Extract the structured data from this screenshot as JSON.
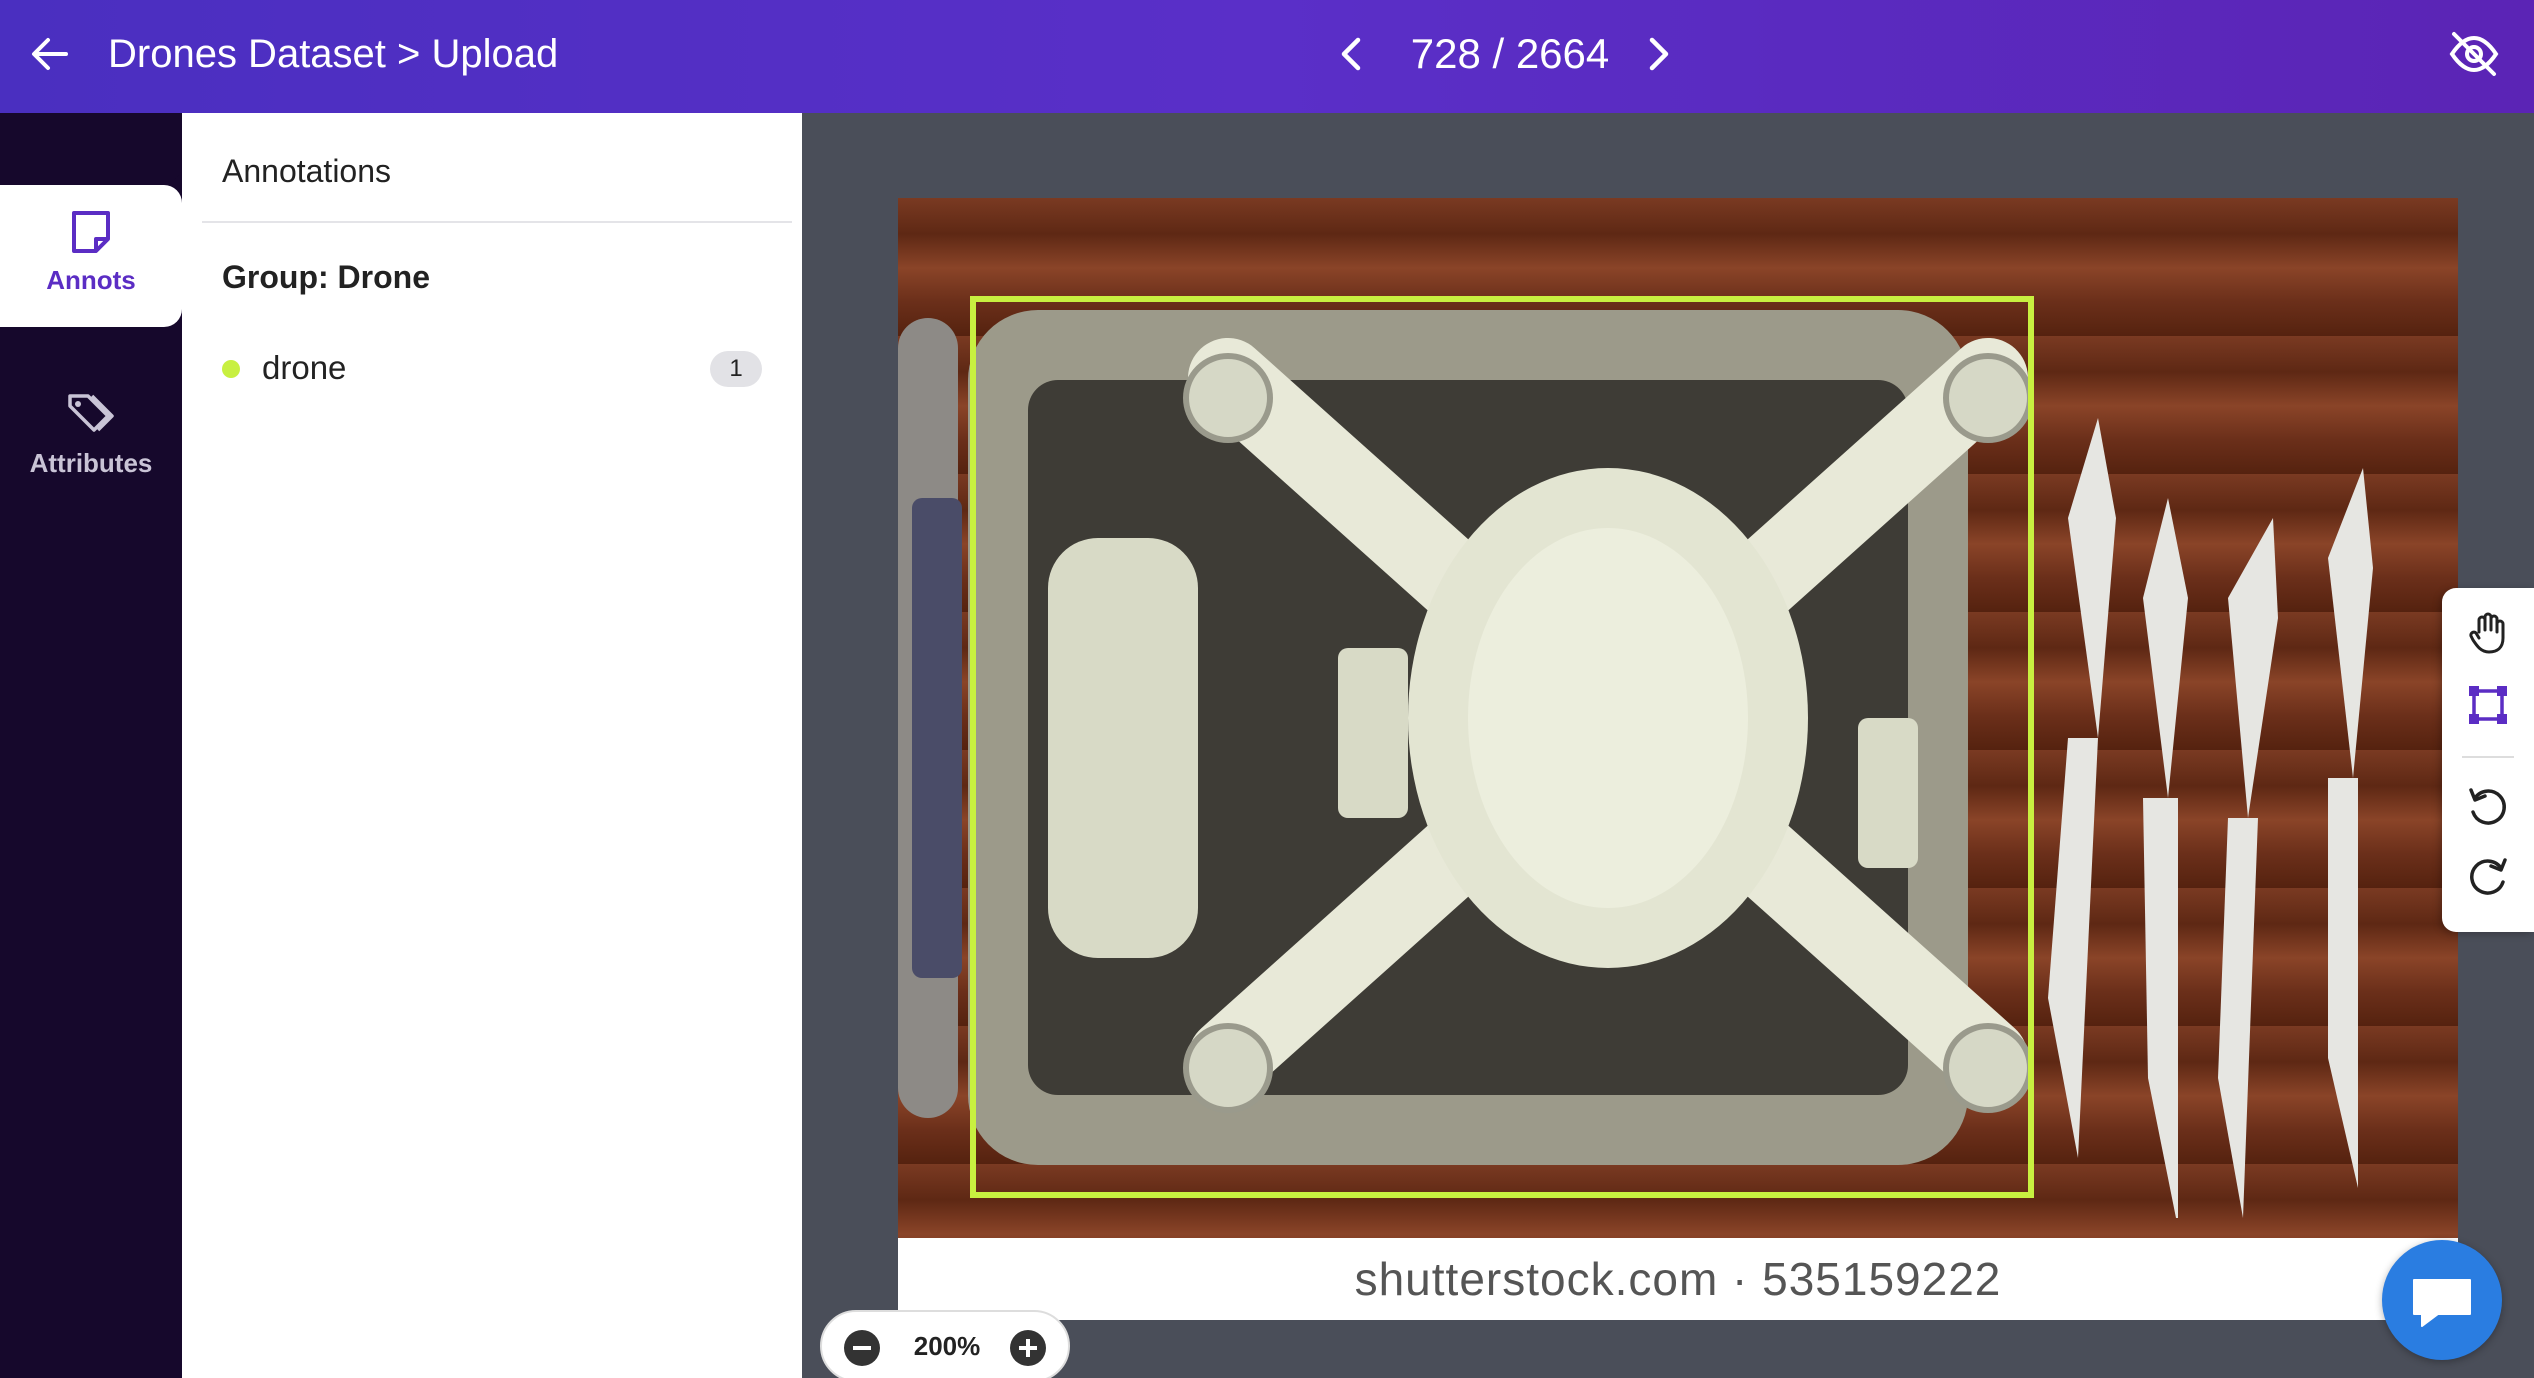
{
  "header": {
    "title": "Drones Dataset > Upload",
    "counter": "728 / 2664"
  },
  "rail": {
    "items": [
      {
        "label": "Annots",
        "icon": "sticky-note-icon",
        "active": true
      },
      {
        "label": "Attributes",
        "icon": "tags-icon",
        "active": false
      }
    ]
  },
  "panel": {
    "heading": "Annotations",
    "group_title": "Group: Drone",
    "annotations": [
      {
        "name": "drone",
        "count": "1",
        "color": "#c8f040"
      }
    ]
  },
  "canvas": {
    "watermark": "shutterstock.com · 535159222",
    "bbox_color": "#c8f040"
  },
  "zoom": {
    "value": "200%"
  },
  "tools": [
    "hand-icon",
    "bounding-box-icon",
    "undo-icon",
    "redo-icon"
  ],
  "colors": {
    "accent": "#5b2dc4",
    "header": "#5a2fc8",
    "rail": "#16082c",
    "chat": "#2a7de1"
  }
}
